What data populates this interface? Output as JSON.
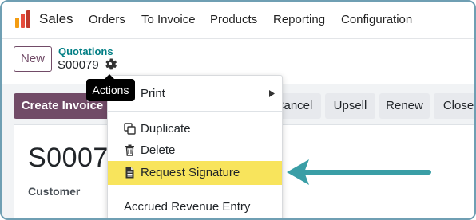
{
  "navbar": {
    "brand": "Sales",
    "menu": [
      "Orders",
      "To Invoice",
      "Products",
      "Reporting",
      "Configuration"
    ]
  },
  "control_panel": {
    "new_label": "New",
    "breadcrumb": "Quotations",
    "record_name": "S00079",
    "gear_icon": "gear-icon"
  },
  "tooltip": "Actions",
  "statusbar": {
    "create_invoice": "Create Invoice",
    "cancel": "Cancel",
    "upsell": "Upsell",
    "renew": "Renew",
    "close": "Close"
  },
  "sheet": {
    "title": "S0007",
    "customer_label": "Customer"
  },
  "actions_menu": {
    "print": "Print",
    "duplicate": "Duplicate",
    "delete": "Delete",
    "request_signature": "Request Signature",
    "accrued": "Accrued Revenue Entry"
  },
  "colors": {
    "brand": "#714b67",
    "highlight": "#f8e45c",
    "annotation_arrow": "#3a9ea6",
    "frame_border": "#6f9fb3"
  }
}
